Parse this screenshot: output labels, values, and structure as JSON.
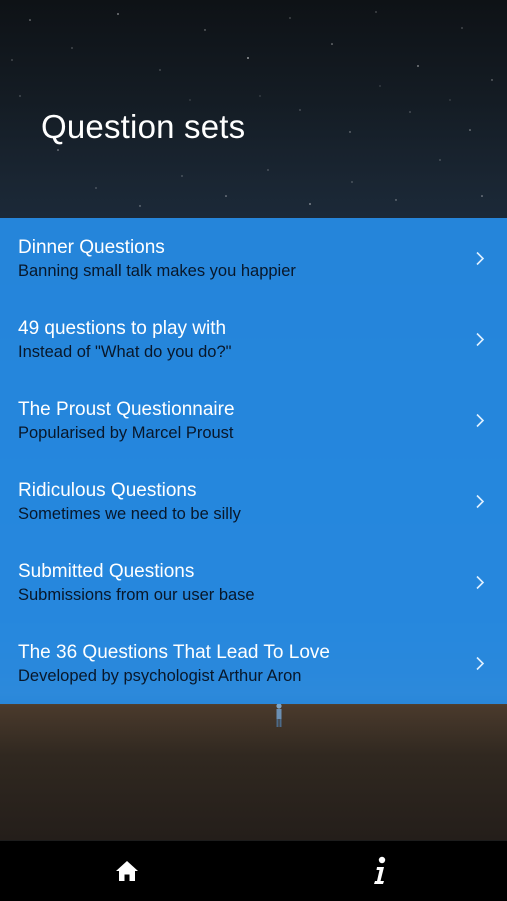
{
  "header": {
    "title": "Question sets"
  },
  "question_sets": [
    {
      "title": "Dinner Questions",
      "subtitle": "Banning small talk makes you happier"
    },
    {
      "title": "49 questions to play with",
      "subtitle": "Instead of \"What do you do?\""
    },
    {
      "title": "The Proust Questionnaire",
      "subtitle": "Popularised by Marcel Proust"
    },
    {
      "title": "Ridiculous Questions",
      "subtitle": "Sometimes we need to be silly"
    },
    {
      "title": "Submitted Questions",
      "subtitle": "Submissions from our user base"
    },
    {
      "title": "The 36 Questions That Lead To Love",
      "subtitle": "Developed by psychologist Arthur Aron"
    }
  ],
  "tab_bar": {
    "tabs": [
      {
        "icon": "home-icon"
      },
      {
        "icon": "info-icon"
      }
    ]
  },
  "colors": {
    "list_background": "#268ce6",
    "title_text": "#ffffff",
    "subtitle_text": "#08172a",
    "tab_bar": "#000000"
  }
}
